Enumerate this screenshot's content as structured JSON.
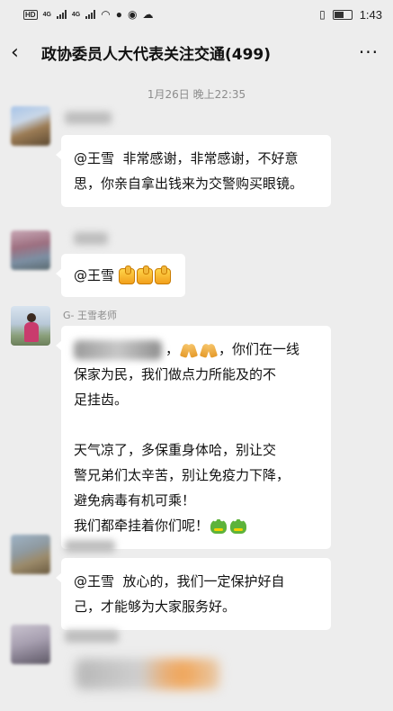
{
  "status_bar": {
    "time": "1:43",
    "network_1": "4G",
    "network_2": "4G"
  },
  "header": {
    "back_icon": "chevron-left-icon",
    "title": "政协委员人大代表关注交通(499)",
    "more_icon": "more-dots-icon",
    "more_glyph": "···"
  },
  "timestamp": "1月26日 晚上22:35",
  "messages": [
    {
      "text": "@王雪  非常感谢，非常感谢，不好意思，你亲自拿出钱来为交警购买眼镜。"
    },
    {
      "text": "@王雪 ",
      "emoji": "thumbs-up-icon x3"
    },
    {
      "sender": "G- 王雪老师",
      "line1_suffix": "，",
      "line1_end": "，你们在一线",
      "rest": "保家为民，我们做点力所能及的不\n足挂齿。\n\n天气凉了，多保重身体哈，别让交\n警兄弟们太辛苦，别让免疫力下降，\n避免病毒有机可乘！\n我们都牵挂着你们呢！"
    },
    {
      "text": "@王雪  放心的，我们一定保护好自\n己，才能够为大家服务好。"
    }
  ],
  "colors": {
    "background": "#ededed",
    "bubble": "#ffffff",
    "timestamp": "#8c8c8c"
  }
}
